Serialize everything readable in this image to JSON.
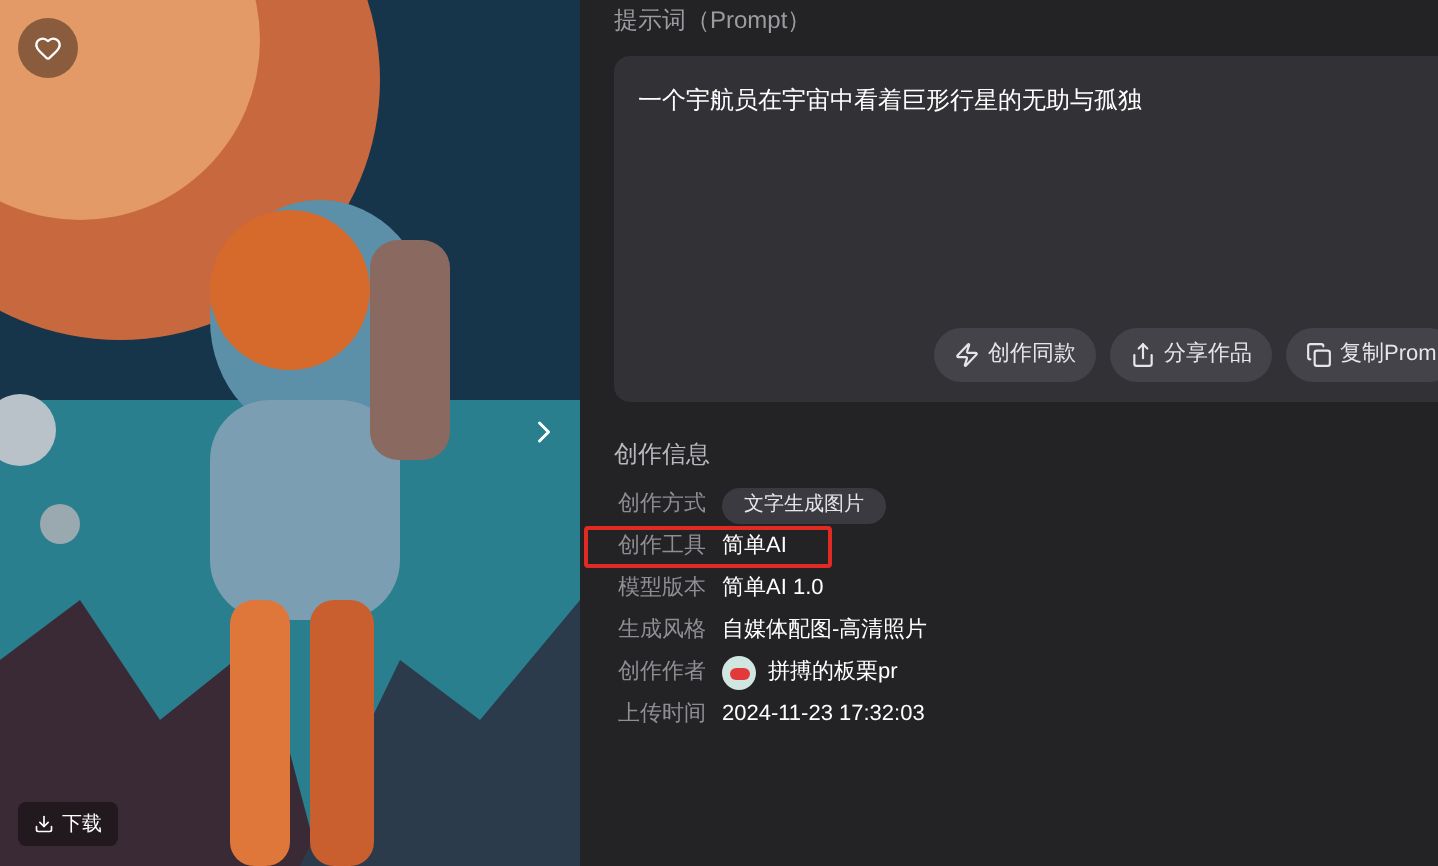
{
  "image_panel": {
    "download_label": "下载"
  },
  "prompt": {
    "label": "提示词（Prompt）",
    "text": "一个宇航员在宇宙中看着巨形行星的无助与孤独",
    "actions": [
      {
        "kind": "spark",
        "label": "创作同款"
      },
      {
        "kind": "share",
        "label": "分享作品"
      },
      {
        "kind": "copy",
        "label": "复制Prom"
      }
    ]
  },
  "info": {
    "title": "创作信息",
    "rows": [
      {
        "kind": "tag",
        "label": "创作方式",
        "value": "文字生成图片",
        "highlighted": false
      },
      {
        "kind": "text",
        "label": "创作工具",
        "value": "简单AI",
        "highlighted": true
      },
      {
        "kind": "text",
        "label": "模型版本",
        "value": "简单AI 1.0",
        "highlighted": false
      },
      {
        "kind": "text",
        "label": "生成风格",
        "value": "自媒体配图-高清照片",
        "highlighted": false
      },
      {
        "kind": "author",
        "label": "创作作者",
        "value": "拼搏的板栗pr",
        "highlighted": false
      },
      {
        "kind": "text",
        "label": "上传时间",
        "value": "2024-11-23 17:32:03",
        "highlighted": false
      }
    ]
  }
}
